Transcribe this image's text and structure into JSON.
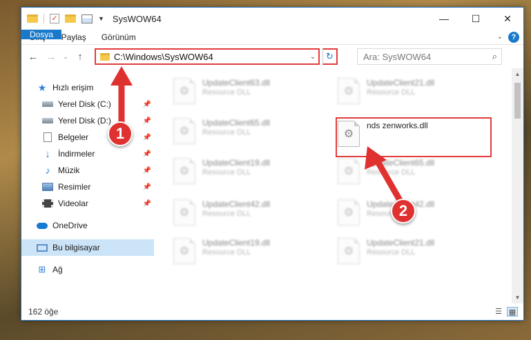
{
  "window": {
    "title": "SysWOW64",
    "controls": {
      "minimize": "—",
      "maximize": "☐",
      "close": "✕"
    }
  },
  "ribbon": {
    "tabs": [
      "Dosya",
      "Giriş",
      "Paylaş",
      "Görünüm"
    ],
    "help": "?",
    "collapse": "⌄"
  },
  "address": {
    "path": "C:\\Windows\\SysWOW64",
    "search_placeholder": "Ara: SysWOW64"
  },
  "sidebar": {
    "quick_access": "Hızlı erişim",
    "items": [
      {
        "label": "Yerel Disk (C:)",
        "icon": "drive-icon"
      },
      {
        "label": "Yerel Disk (D:)",
        "icon": "drive-icon"
      },
      {
        "label": "Belgeler",
        "icon": "documents-icon"
      },
      {
        "label": "İndirmeler",
        "icon": "download-icon"
      },
      {
        "label": "Müzik",
        "icon": "music-icon"
      },
      {
        "label": "Resimler",
        "icon": "pictures-icon"
      },
      {
        "label": "Videolar",
        "icon": "videos-icon"
      }
    ],
    "onedrive": "OneDrive",
    "this_pc": "Bu bilgisayar",
    "network": "Ağ"
  },
  "files": {
    "col1": [
      {
        "name": "UpdateClient63.dll",
        "type": "Resource DLL"
      },
      {
        "name": "UpdateClient65.dll",
        "type": "Resource DLL"
      },
      {
        "name": "UpdateClient19.dll",
        "type": "Resource DLL"
      },
      {
        "name": "UpdateClient42.dll",
        "type": "Resource DLL"
      },
      {
        "name": "UpdateClient19.dll",
        "type": "Resource DLL"
      }
    ],
    "col2": [
      {
        "name": "UpdateClient21.dll",
        "type": "Resource DLL"
      },
      {
        "name": "nds zenworks.dll",
        "type": ""
      },
      {
        "name": "UpdateClient65.dll",
        "type": "Resource DLL"
      },
      {
        "name": "UpdateClient42.dll",
        "type": "Resource DLL"
      },
      {
        "name": "UpdateClient21.dll",
        "type": "Resource DLL"
      }
    ]
  },
  "status": {
    "count": "162 öğe"
  },
  "annotations": {
    "step1": "1",
    "step2": "2",
    "accent": "#e03131"
  }
}
